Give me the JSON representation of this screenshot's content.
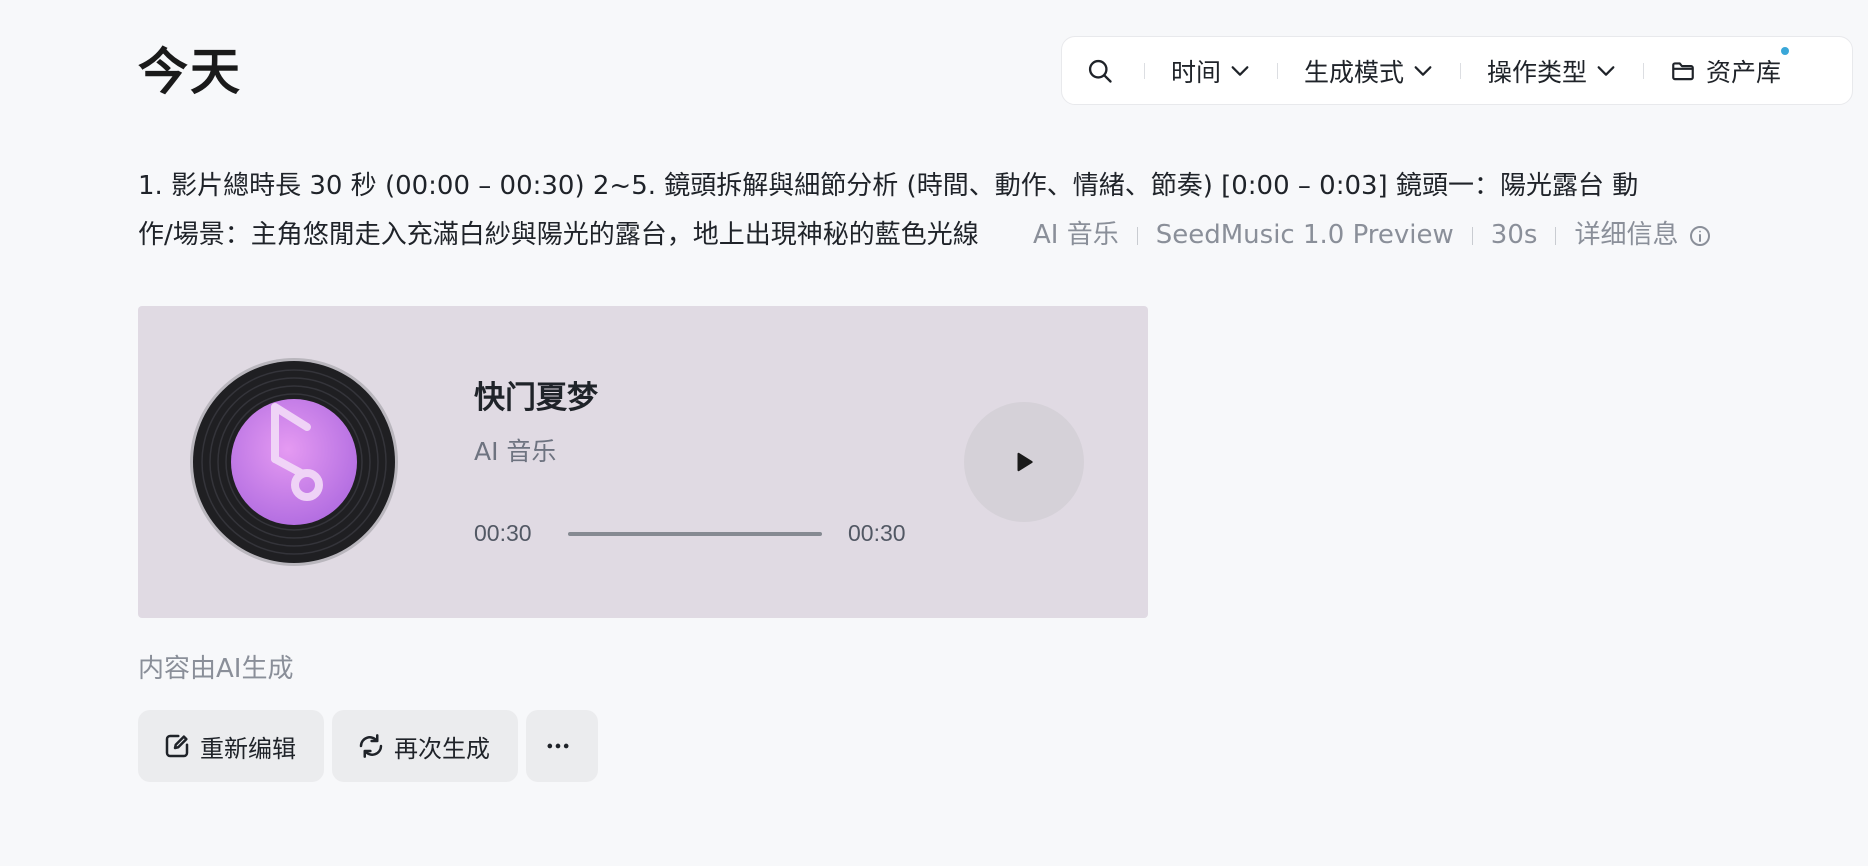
{
  "page": {
    "title": "今天"
  },
  "filter_bar": {
    "search_icon": "search-icon",
    "time_label": "时间",
    "mode_label": "生成模式",
    "op_label": "操作类型",
    "asset_label": "资产库",
    "badge_color": "#3aa7d8"
  },
  "record": {
    "prompt_line1": "1. 影片總時長 30 秒 (00:00 – 00:30) 2~5. 鏡頭拆解與細節分析 (時間、動作、情緒、節奏) [0:00 – 0:03] 鏡頭一：陽光露台 動",
    "prompt_line2": "作/場景：主角悠閒走入充滿白紗與陽光的露台，地上出現神秘的藍色光線",
    "meta": {
      "type": "AI 音乐",
      "model": "SeedMusic 1.0 Preview",
      "duration": "30s",
      "details": "详细信息"
    }
  },
  "player": {
    "title": "快门夏梦",
    "subtitle": "AI 音乐",
    "current_time": "00:30",
    "total_time": "00:30",
    "progress": 1.0,
    "card_color": "#e0dae3",
    "cover_color": "#c77ae8"
  },
  "footer": {
    "ai_note": "内容由AI生成",
    "reedit_label": "重新编辑",
    "regenerate_label": "再次生成"
  }
}
